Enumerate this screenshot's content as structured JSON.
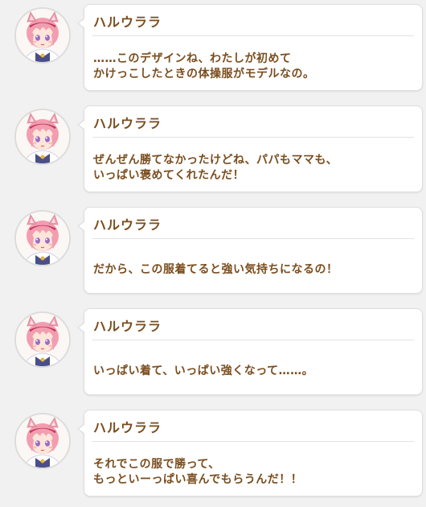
{
  "colors": {
    "background": "#f1f1f1",
    "bubble": "#ffffff",
    "text": "#7a4d1e",
    "hair": "#f29db0",
    "eyes": "#9a6cc4"
  },
  "messages": [
    {
      "speaker": "ハルウララ",
      "avatar_icon": "haru-urara-portrait-icon",
      "lines": [
        "……このデザインね、わたしが初めて",
        "かけっこしたときの体操服がモデルなの。"
      ]
    },
    {
      "speaker": "ハルウララ",
      "avatar_icon": "haru-urara-portrait-icon",
      "lines": [
        "ぜんぜん勝てなかったけどね、パパもママも、",
        "いっぱい褒めてくれたんだ！"
      ]
    },
    {
      "speaker": "ハルウララ",
      "avatar_icon": "haru-urara-portrait-icon",
      "lines": [
        "だから、この服着てると強い気持ちになるの！"
      ]
    },
    {
      "speaker": "ハルウララ",
      "avatar_icon": "haru-urara-portrait-icon",
      "lines": [
        "いっぱい着て、いっぱい強くなって……。"
      ]
    },
    {
      "speaker": "ハルウララ",
      "avatar_icon": "haru-urara-portrait-icon",
      "lines": [
        "それでこの服で勝って、",
        "もっといーっぱい喜んでもらうんだ！！"
      ]
    }
  ]
}
